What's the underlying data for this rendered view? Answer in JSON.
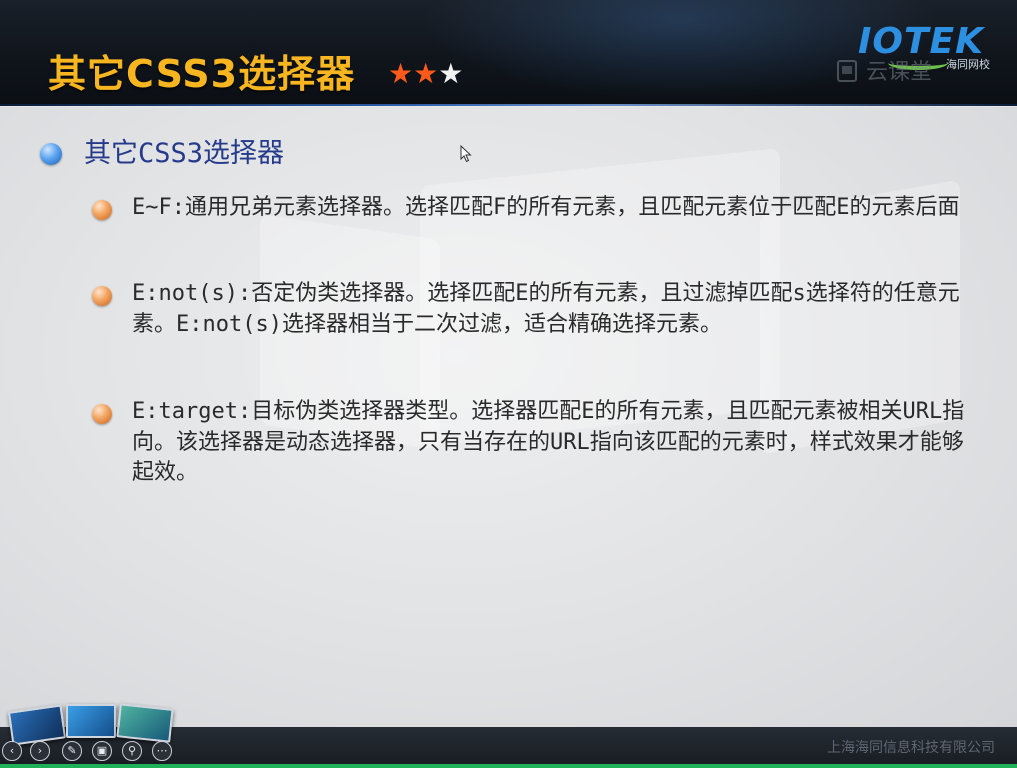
{
  "slide": {
    "title": "其它CSS3选择器",
    "stars_filled": 2,
    "stars_total": 3,
    "logo": {
      "brand": "IOTEK",
      "tagline": "海同网校"
    },
    "watermark": "云课堂",
    "heading": "其它CSS3选择器",
    "items": [
      {
        "text": "E~F:通用兄弟元素选择器。选择匹配F的所有元素，且匹配元素位于匹配E的元素后面"
      },
      {
        "text": "E:not(s):否定伪类选择器。选择匹配E的所有元素，且过滤掉匹配s选择符的任意元素。E:not(s)选择器相当于二次过滤，适合精确选择元素。"
      },
      {
        "text": "E:target:目标伪类选择器类型。选择器匹配E的所有元素，且匹配元素被相关URL指向。该选择器是动态选择器，只有当存在的URL指向该匹配的元素时，样式效果才能够起效。"
      }
    ]
  },
  "footer": {
    "company": "上海海同信息科技有限公司",
    "controls": [
      {
        "name": "previous",
        "icon": "chevron-left-icon",
        "glyph": "‹"
      },
      {
        "name": "next",
        "icon": "chevron-right-icon",
        "glyph": "›"
      },
      {
        "name": "pen",
        "icon": "pen-icon",
        "glyph": "✎"
      },
      {
        "name": "slides",
        "icon": "slides-icon",
        "glyph": "▣"
      },
      {
        "name": "zoom",
        "icon": "magnifier-icon",
        "glyph": "⚲"
      },
      {
        "name": "more",
        "icon": "more-icon",
        "glyph": "⋯"
      }
    ]
  },
  "colors": {
    "title": "#f7b520",
    "star_orange": "#ff5a1a",
    "heading": "#253a8a",
    "footer_green": "#1fb05a"
  }
}
